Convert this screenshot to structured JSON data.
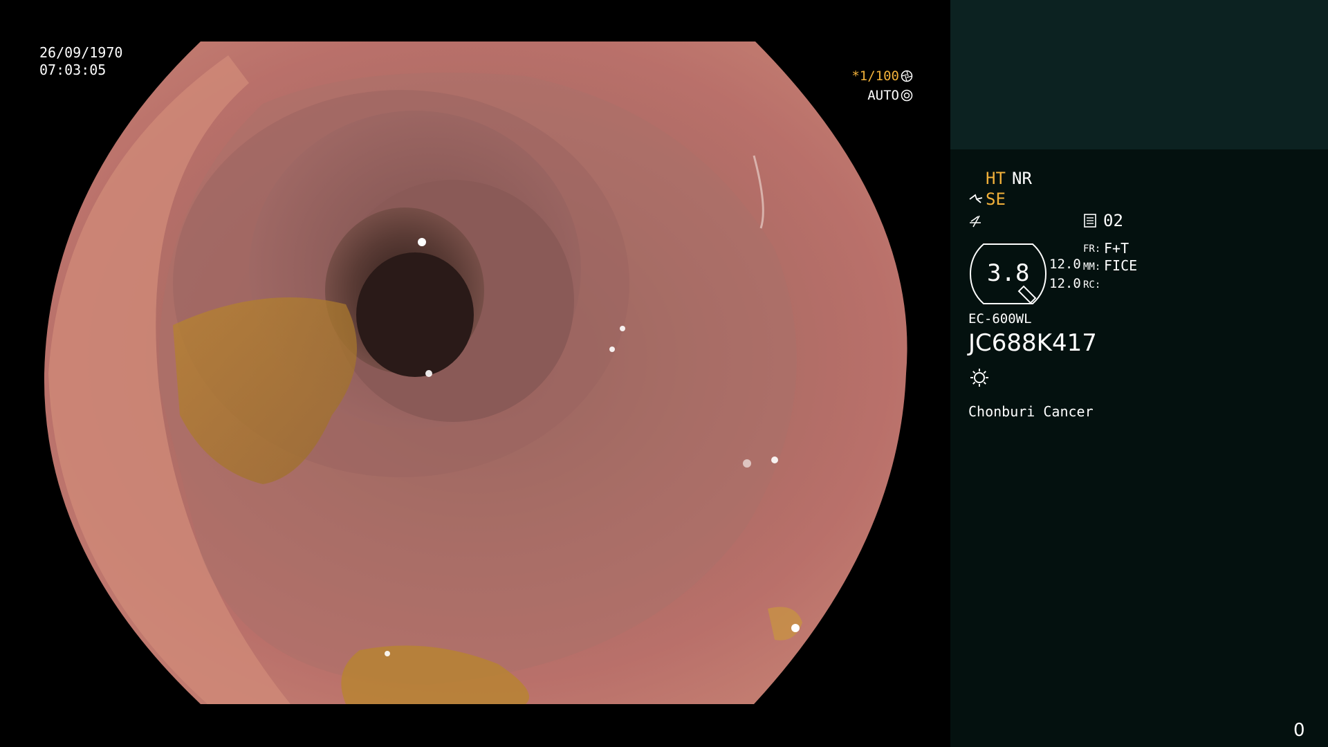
{
  "osd": {
    "date": "26/09/1970",
    "time": "07:03:05",
    "shutter": "*1/100",
    "shutter_icon": "shutter-icon",
    "iris_mode": "AUTO",
    "iris_icon": "iris-icon"
  },
  "panel": {
    "ht": "HT",
    "nr": "NR",
    "se": "SE",
    "se_icon": "scope-tip-icon",
    "f_icon": "enhancement-icon",
    "memory_icon": "memory-card-icon",
    "memory": "02",
    "zoom": "3.8",
    "level_1": "12.0",
    "level_2": "12.0",
    "fr_key": "FR:",
    "fr_value": "F+T",
    "mm_key": "MM:",
    "mm_value": "FICE",
    "rc_key": "RC:",
    "scope_model": "EC-600WL",
    "scope_serial": "JC688K417",
    "light_icon": "light-source-icon",
    "institution": "Chonburi Cancer",
    "counter": "0"
  },
  "colors": {
    "accent_orange": "#f2b13a",
    "panel_top": "#0c2221",
    "panel_bottom": "#04110f",
    "mucosa": "#b86a5e"
  }
}
